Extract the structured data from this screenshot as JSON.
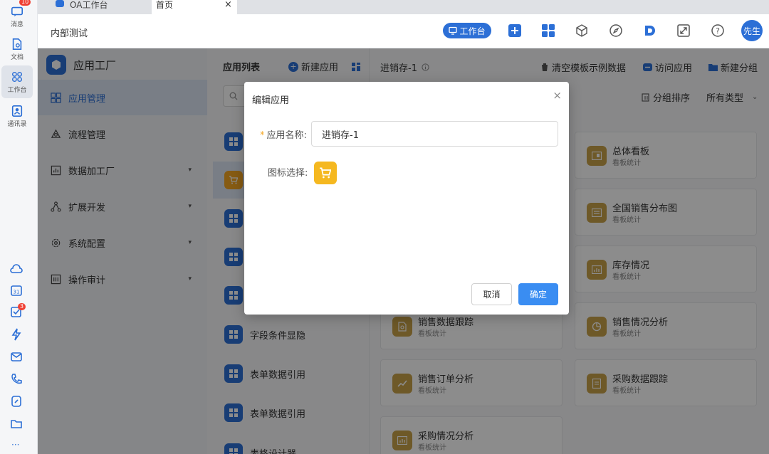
{
  "rail": {
    "messages_label": "消息",
    "messages_badge": "10",
    "docs_label": "文档",
    "workbench_label": "工作台",
    "contacts_label": "通讯录",
    "todo_badge": "3",
    "more_label": "···"
  },
  "tabs": [
    {
      "label": "OA工作台"
    },
    {
      "label": "首页",
      "close": "×"
    }
  ],
  "header": {
    "title": "内部测试",
    "workbench_button": "工作台",
    "avatar_text": "先生"
  },
  "menu": {
    "title": "应用工厂",
    "items": [
      {
        "label": "应用管理"
      },
      {
        "label": "流程管理"
      },
      {
        "label": "数据加工厂"
      },
      {
        "label": "扩展开发"
      },
      {
        "label": "系统配置"
      },
      {
        "label": "操作审计"
      }
    ],
    "caret": "▾"
  },
  "app_list": {
    "title": "应用列表",
    "new_app": "新建应用",
    "rows": [
      {
        "label": ""
      },
      {
        "label": ""
      },
      {
        "label": ""
      },
      {
        "label": ""
      },
      {
        "label": ""
      },
      {
        "label": "字段条件显隐"
      },
      {
        "label": "表单数据引用"
      },
      {
        "label": "表单数据引用"
      },
      {
        "label": "表格设计器"
      }
    ]
  },
  "content": {
    "title": "进销存-1",
    "clear_template": "清空模板示例数据",
    "visit_app": "访问应用",
    "new_group": "新建分组",
    "group_sort": "分组排序",
    "all_types": "所有类型",
    "cards": [
      {
        "name": "总体看板",
        "sub": "看板统计"
      },
      {
        "name": "全国销售分布图",
        "sub": "看板统计"
      },
      {
        "name": "库存情况",
        "sub": "看板统计"
      },
      {
        "name": "销售数据跟踪",
        "sub": "看板统计"
      },
      {
        "name": "销售情况分析",
        "sub": "看板统计"
      },
      {
        "name": "销售订单分析",
        "sub": "看板统计"
      },
      {
        "name": "采购数据跟踪",
        "sub": "看板统计"
      },
      {
        "name": "采购情况分析",
        "sub": "看板统计"
      }
    ]
  },
  "modal": {
    "title": "编辑应用",
    "close": "×",
    "name_required_mark": "*",
    "name_label": "应用名称:",
    "name_value": "进销存-1",
    "icon_label": "图标选择:",
    "cancel": "取消",
    "confirm": "确定"
  },
  "colors": {
    "primary": "#2c6fd6",
    "confirm_button": "#3a8df2",
    "app_icon_yellow": "#f5b820",
    "card_icon": "#c9a24a",
    "badge_red": "#f04134"
  }
}
